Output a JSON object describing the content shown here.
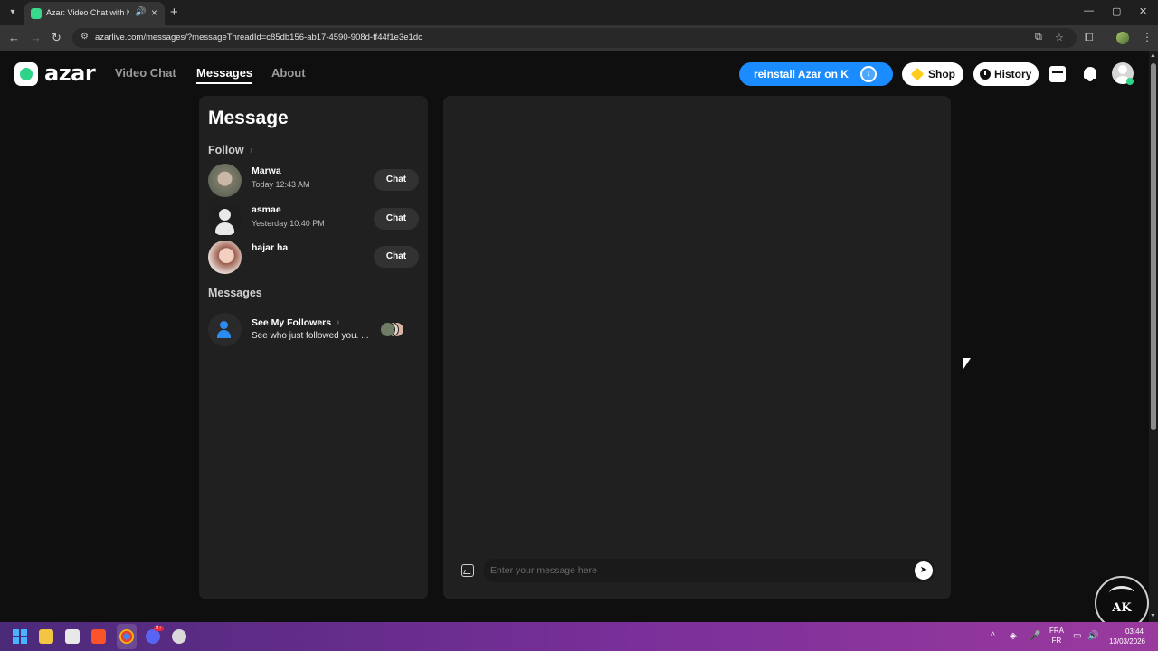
{
  "browser": {
    "tab_title": "Azar: Video Chat with New",
    "url": "azarlive.com/messages/?messageThreadId=c85db156-ab17-4590-908d-ff44f1e3e1dc"
  },
  "header": {
    "logo_text": "azar",
    "nav": [
      {
        "label": "Video Chat",
        "active": false
      },
      {
        "label": "Messages",
        "active": true
      },
      {
        "label": "About",
        "active": false
      }
    ],
    "install_label": "reinstall Azar on K",
    "shop_label": "Shop",
    "history_label": "History"
  },
  "messages_panel": {
    "title": "Message",
    "follow_section": "Follow",
    "contacts": [
      {
        "name": "Marwa",
        "time": "Today 12:43 AM",
        "action": "Chat"
      },
      {
        "name": "asmae",
        "time": "Yesterday 10:40 PM",
        "action": "Chat"
      },
      {
        "name": "hajar ha",
        "time": "",
        "action": "Chat"
      }
    ],
    "messages_section": "Messages",
    "followers": {
      "title": "See My Followers",
      "subtitle": "See who just followed you. ..."
    }
  },
  "chat": {
    "input_placeholder": "Enter your message here"
  },
  "taskbar": {
    "lang_top": "FRA",
    "lang_bottom": "FR",
    "time": "03:44",
    "date": "13/03/2026",
    "discord_badge": "9+"
  },
  "watermark": {
    "text": "AK"
  },
  "colors": {
    "accent": "#1a8cff",
    "brand_green": "#30d38a",
    "panel_bg": "#202020",
    "page_bg": "#0f0f0f"
  }
}
